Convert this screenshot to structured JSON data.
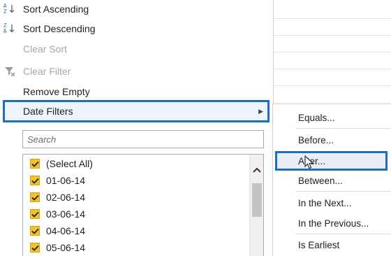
{
  "menu": {
    "sort_ascending": "Sort Ascending",
    "sort_descending": "Sort Descending",
    "clear_sort": "Clear Sort",
    "clear_filter": "Clear Filter",
    "remove_empty": "Remove Empty",
    "date_filters": "Date Filters"
  },
  "search": {
    "placeholder": "Search"
  },
  "values_list": [
    {
      "label": "(Select All)",
      "checked": true
    },
    {
      "label": "01-06-14",
      "checked": true
    },
    {
      "label": "02-06-14",
      "checked": true
    },
    {
      "label": "03-06-14",
      "checked": true
    },
    {
      "label": "04-06-14",
      "checked": true
    },
    {
      "label": "05-06-14",
      "checked": true
    }
  ],
  "date_submenu": {
    "items": [
      "Equals...",
      "Before...",
      "After...",
      "Between...",
      "In the Next...",
      "In the Previous...",
      "Is Earliest"
    ]
  },
  "colors": {
    "highlight_border": "#1a6fc4",
    "checkbox": "#f2c22e"
  },
  "icons": [
    "sort-ascending-icon",
    "sort-descending-icon",
    "clear-filter-icon",
    "submenu-arrow-icon",
    "checkmark-icon",
    "scroll-up-icon",
    "mouse-cursor-icon"
  ]
}
